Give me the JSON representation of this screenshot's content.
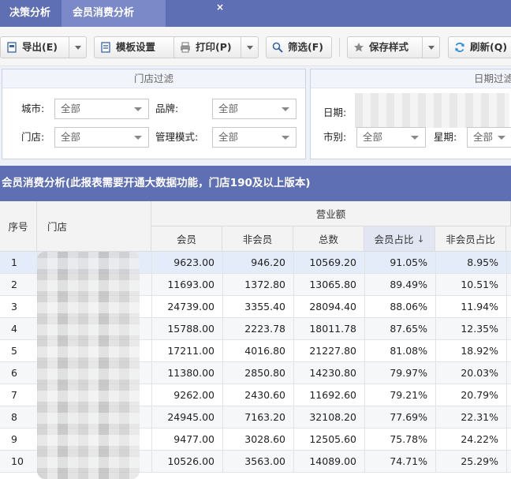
{
  "tabs": [
    {
      "label": "决策分析",
      "active": false
    },
    {
      "label": "会员消费分析",
      "active": true
    }
  ],
  "tab_close": "×",
  "toolbar": {
    "export": "导出(E)",
    "template": "模板设置",
    "print": "打印(P)",
    "filter": "筛选(F)",
    "save_style": "保存样式",
    "refresh": "刷新(Q)"
  },
  "filters": {
    "store_panel_title": "门店过滤",
    "date_panel_title": "日期过滤",
    "city_label": "城市:",
    "city_value": "全部",
    "brand_label": "品牌:",
    "brand_value": "全部",
    "store_label": "门店:",
    "store_value": "全部",
    "mode_label": "管理模式:",
    "mode_value": "全部",
    "date_label": "日期:",
    "city2_label": "市别:",
    "city2_value": "全部",
    "week_label": "星期:",
    "week_value": "全部"
  },
  "report_title": "会员消费分析(此报表需要开通大数据功能，门店190及以上版本)",
  "table": {
    "headers": {
      "index": "序号",
      "store": "门店",
      "group": "营业额",
      "member": "会员",
      "non_member": "非会员",
      "total": "总数",
      "member_ratio": "会员占比",
      "non_member_ratio": "非会员占比"
    },
    "sort_arrow": "↓",
    "rows": [
      {
        "idx": "1",
        "member": "9623.00",
        "non_member": "946.20",
        "total": "10569.20",
        "member_ratio": "91.05%",
        "non_member_ratio": "8.95%"
      },
      {
        "idx": "2",
        "member": "11693.00",
        "non_member": "1372.80",
        "total": "13065.80",
        "member_ratio": "89.49%",
        "non_member_ratio": "10.51%"
      },
      {
        "idx": "3",
        "member": "24739.00",
        "non_member": "3355.40",
        "total": "28094.40",
        "member_ratio": "88.06%",
        "non_member_ratio": "11.94%"
      },
      {
        "idx": "4",
        "member": "15788.00",
        "non_member": "2223.78",
        "total": "18011.78",
        "member_ratio": "87.65%",
        "non_member_ratio": "12.35%"
      },
      {
        "idx": "5",
        "member": "17211.00",
        "non_member": "4016.80",
        "total": "21227.80",
        "member_ratio": "81.08%",
        "non_member_ratio": "18.92%"
      },
      {
        "idx": "6",
        "member": "11380.00",
        "non_member": "2850.80",
        "total": "14230.80",
        "member_ratio": "79.97%",
        "non_member_ratio": "20.03%"
      },
      {
        "idx": "7",
        "member": "9262.00",
        "non_member": "2430.60",
        "total": "11692.60",
        "member_ratio": "79.21%",
        "non_member_ratio": "20.79%"
      },
      {
        "idx": "8",
        "member": "24945.00",
        "non_member": "7163.20",
        "total": "32108.20",
        "member_ratio": "77.69%",
        "non_member_ratio": "22.31%"
      },
      {
        "idx": "9",
        "member": "9477.00",
        "non_member": "3028.60",
        "total": "12505.60",
        "member_ratio": "75.78%",
        "non_member_ratio": "24.22%"
      },
      {
        "idx": "10",
        "member": "10526.00",
        "non_member": "3563.00",
        "total": "14089.00",
        "member_ratio": "74.71%",
        "non_member_ratio": "25.29%"
      }
    ]
  },
  "colors": {
    "header_bar": "#5f6fb3",
    "active_tab": "#7b89c9",
    "selected_row": "#e4ecfa"
  },
  "icons": [
    "export-icon",
    "template-icon",
    "print-icon",
    "search-icon",
    "star-icon",
    "refresh-icon"
  ]
}
